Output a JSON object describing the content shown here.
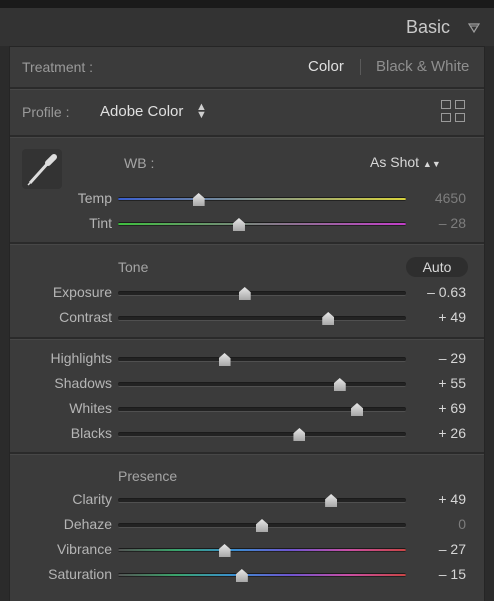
{
  "header": {
    "title": "Basic"
  },
  "treatment": {
    "label": "Treatment :",
    "color": "Color",
    "bw": "Black & White"
  },
  "profile": {
    "label": "Profile :",
    "value": "Adobe Color"
  },
  "wb": {
    "label": "WB :",
    "value": "As Shot",
    "sliders": [
      {
        "name": "temp",
        "label": "Temp",
        "value": "4650",
        "fraction": 0.28,
        "track": "temp",
        "dim": true
      },
      {
        "name": "tint",
        "label": "Tint",
        "value": "– 28",
        "fraction": 0.42,
        "track": "tint",
        "dim": true
      }
    ]
  },
  "tone": {
    "title": "Tone",
    "auto": "Auto",
    "sliders": [
      {
        "name": "exposure",
        "label": "Exposure",
        "value": "– 0.63",
        "fraction": 0.44
      },
      {
        "name": "contrast",
        "label": "Contrast",
        "value": "+ 49",
        "fraction": 0.73
      }
    ]
  },
  "tone2": {
    "sliders": [
      {
        "name": "highlights",
        "label": "Highlights",
        "value": "– 29",
        "fraction": 0.37
      },
      {
        "name": "shadows",
        "label": "Shadows",
        "value": "+ 55",
        "fraction": 0.77
      },
      {
        "name": "whites",
        "label": "Whites",
        "value": "+ 69",
        "fraction": 0.83
      },
      {
        "name": "blacks",
        "label": "Blacks",
        "value": "+ 26",
        "fraction": 0.63
      }
    ]
  },
  "presence": {
    "title": "Presence",
    "sliders": [
      {
        "name": "clarity",
        "label": "Clarity",
        "value": "+ 49",
        "fraction": 0.74
      },
      {
        "name": "dehaze",
        "label": "Dehaze",
        "value": "0",
        "fraction": 0.5,
        "dim": true
      },
      {
        "name": "vibrance",
        "label": "Vibrance",
        "value": "– 27",
        "fraction": 0.37,
        "track": "spectrum"
      },
      {
        "name": "saturation",
        "label": "Saturation",
        "value": "– 15",
        "fraction": 0.43,
        "track": "spectrum"
      }
    ]
  },
  "colors": {
    "temp_start": "#3a5fd0",
    "temp_end": "#d7d23c",
    "tint_start": "#3fbf3f",
    "tint_end": "#c23ec9"
  }
}
